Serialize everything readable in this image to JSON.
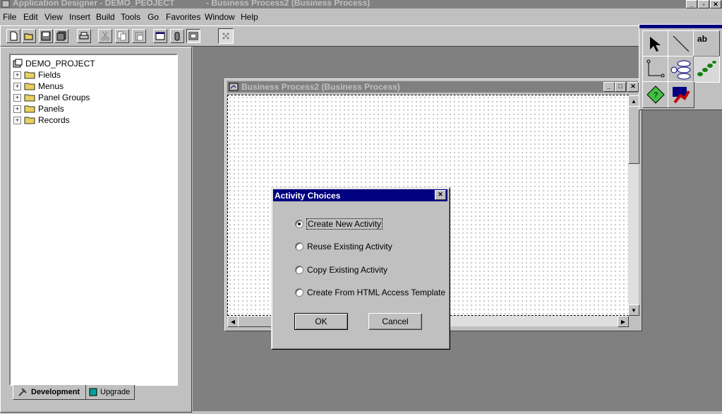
{
  "app": {
    "title": "Application Designer - DEMO_PEOJECT",
    "doc_title": "- Business Process2 (Business Process)"
  },
  "menu": [
    {
      "label": "File"
    },
    {
      "label": "Edit"
    },
    {
      "label": "View"
    },
    {
      "label": "Insert"
    },
    {
      "label": "Build"
    },
    {
      "label": "Tools"
    },
    {
      "label": "Go"
    },
    {
      "label": "Favorites"
    },
    {
      "label": "Window"
    },
    {
      "label": "Help"
    }
  ],
  "toolbar": {
    "icons": [
      "new-icon",
      "open-icon",
      "save-icon",
      "save-all-icon",
      "print-icon",
      "cut-icon",
      "copy-icon",
      "paste-icon",
      "properties-icon",
      "find-icon",
      "project-icon",
      "grid-icon"
    ]
  },
  "project": {
    "root": "DEMO_PROJECT",
    "items": [
      {
        "label": "Fields"
      },
      {
        "label": "Menus"
      },
      {
        "label": "Panel Groups"
      },
      {
        "label": "Panels"
      },
      {
        "label": "Records"
      }
    ],
    "tabs": [
      {
        "label": "Development"
      },
      {
        "label": "Upgrade"
      }
    ]
  },
  "child_window": {
    "title": "Business Process2 (Business Process)"
  },
  "palette": {
    "text_tool": "ab"
  },
  "dialog": {
    "title": "Activity Choices",
    "options": [
      {
        "label": "Create New Activity",
        "selected": true
      },
      {
        "label": "Reuse Existing Activity",
        "selected": false
      },
      {
        "label": "Copy Existing Activity",
        "selected": false
      },
      {
        "label": "Create From HTML Access Template",
        "selected": false
      }
    ],
    "ok_label": "OK",
    "cancel_label": "Cancel"
  },
  "colors": {
    "dialog_title_bg": "#000080",
    "inactive_title_bg": "#808080",
    "face": "#c0c0c0",
    "workspace": "#808080"
  }
}
